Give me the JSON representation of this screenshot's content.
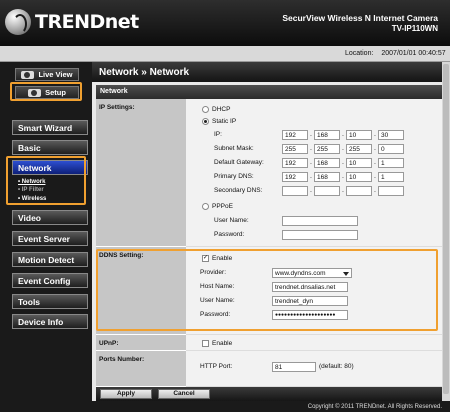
{
  "brand": {
    "logo_text": "TRENDnet",
    "product_line1": "SecurView Wireless N Internet Camera",
    "product_line2": "TV-IP110WN"
  },
  "location": {
    "label": "Location:",
    "datetime": "2007/01/01 00:40:57"
  },
  "sidebar": {
    "live_view": "Live View",
    "setup": "Setup",
    "menu": [
      "Smart Wizard",
      "Basic",
      "Network",
      "Video",
      "Event Server",
      "Motion Detect",
      "Event Config",
      "Tools",
      "Device Info"
    ],
    "network_sub": [
      "• Network",
      "• IP Filter",
      "• Wireless"
    ]
  },
  "page": {
    "title": "Network » Network",
    "section": "Network"
  },
  "ip_settings": {
    "label": "IP Settings:",
    "dhcp": "DHCP",
    "static_ip": "Static IP",
    "ip_label": "IP:",
    "ip": [
      "192",
      "168",
      "10",
      "30"
    ],
    "mask_label": "Subnet Mask:",
    "mask": [
      "255",
      "255",
      "255",
      "0"
    ],
    "gw_label": "Default Gateway:",
    "gw": [
      "192",
      "168",
      "10",
      "1"
    ],
    "dns1_label": "Primary DNS:",
    "dns1": [
      "192",
      "168",
      "10",
      "1"
    ],
    "dns2_label": "Secondary DNS:",
    "dns2": [
      "",
      "",
      "",
      ""
    ],
    "pppoe": "PPPoE",
    "user_label": "User Name:",
    "pass_label": "Password:"
  },
  "ddns": {
    "label": "DDNS Setting:",
    "enable": "Enable",
    "provider_label": "Provider:",
    "provider": "www.dyndns.com",
    "host_label": "Host Name:",
    "host": "trendnet.dnsalias.net",
    "user_label": "User Name:",
    "user": "trendnet_dyn",
    "pass_label": "Password:",
    "pass": "●●●●●●●●●●●●●●●●●●●●"
  },
  "upnp": {
    "label": "UPnP:",
    "enable": "Enable"
  },
  "ports": {
    "label": "Ports Number:",
    "http_label": "HTTP Port:",
    "http": "81",
    "default": "(default: 80)"
  },
  "actions": {
    "apply": "Apply",
    "cancel": "Cancel"
  },
  "footer": "Copyright © 2011 TRENDnet. All Rights Reserved.",
  "colors": {
    "highlight": "#f0a030",
    "active_menu": "#1d3fb8"
  }
}
